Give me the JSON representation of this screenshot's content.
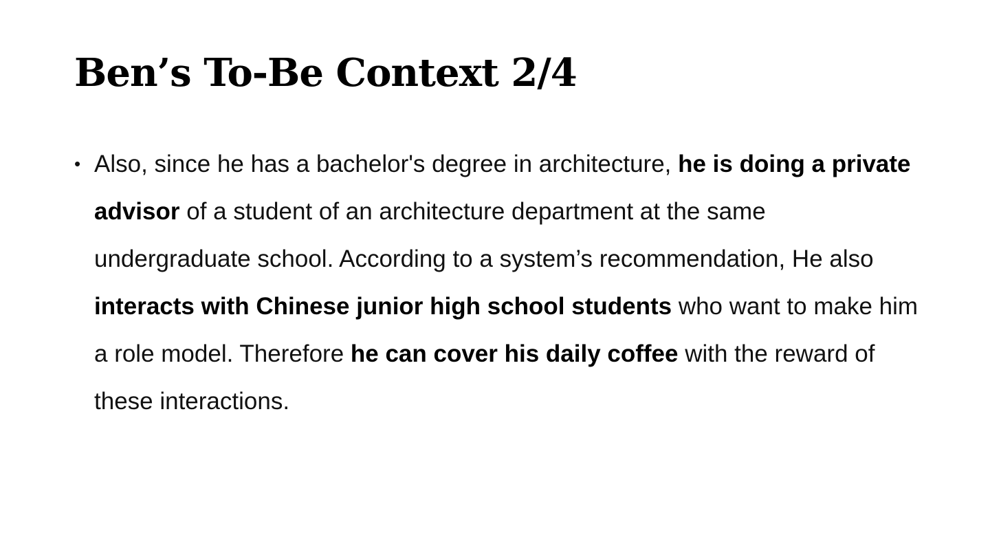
{
  "slide": {
    "title": "Ben’s To-Be Context 2/4",
    "bullet_marker": "•",
    "bullet": {
      "seg1": "Also, since he has a bachelor's degree in architecture, ",
      "seg2": "he is doing a private advisor",
      "seg3": " of a student of an architecture department at the same undergraduate school. According to a system’s recommendation, He also ",
      "seg4": "interacts with Chinese junior high school students",
      "seg5": " who want to make him a role model. Therefore ",
      "seg6": "he can cover his daily coffee",
      "seg7": " with the reward of these interactions."
    }
  }
}
